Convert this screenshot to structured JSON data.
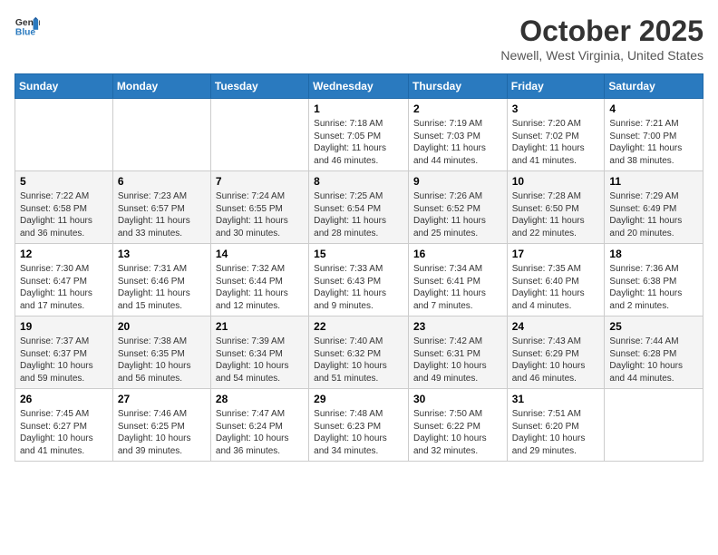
{
  "header": {
    "logo_line1": "General",
    "logo_line2": "Blue",
    "title": "October 2025",
    "subtitle": "Newell, West Virginia, United States"
  },
  "weekdays": [
    "Sunday",
    "Monday",
    "Tuesday",
    "Wednesday",
    "Thursday",
    "Friday",
    "Saturday"
  ],
  "weeks": [
    [
      {
        "day": "",
        "data": ""
      },
      {
        "day": "",
        "data": ""
      },
      {
        "day": "",
        "data": ""
      },
      {
        "day": "1",
        "data": "Sunrise: 7:18 AM\nSunset: 7:05 PM\nDaylight: 11 hours and 46 minutes."
      },
      {
        "day": "2",
        "data": "Sunrise: 7:19 AM\nSunset: 7:03 PM\nDaylight: 11 hours and 44 minutes."
      },
      {
        "day": "3",
        "data": "Sunrise: 7:20 AM\nSunset: 7:02 PM\nDaylight: 11 hours and 41 minutes."
      },
      {
        "day": "4",
        "data": "Sunrise: 7:21 AM\nSunset: 7:00 PM\nDaylight: 11 hours and 38 minutes."
      }
    ],
    [
      {
        "day": "5",
        "data": "Sunrise: 7:22 AM\nSunset: 6:58 PM\nDaylight: 11 hours and 36 minutes."
      },
      {
        "day": "6",
        "data": "Sunrise: 7:23 AM\nSunset: 6:57 PM\nDaylight: 11 hours and 33 minutes."
      },
      {
        "day": "7",
        "data": "Sunrise: 7:24 AM\nSunset: 6:55 PM\nDaylight: 11 hours and 30 minutes."
      },
      {
        "day": "8",
        "data": "Sunrise: 7:25 AM\nSunset: 6:54 PM\nDaylight: 11 hours and 28 minutes."
      },
      {
        "day": "9",
        "data": "Sunrise: 7:26 AM\nSunset: 6:52 PM\nDaylight: 11 hours and 25 minutes."
      },
      {
        "day": "10",
        "data": "Sunrise: 7:28 AM\nSunset: 6:50 PM\nDaylight: 11 hours and 22 minutes."
      },
      {
        "day": "11",
        "data": "Sunrise: 7:29 AM\nSunset: 6:49 PM\nDaylight: 11 hours and 20 minutes."
      }
    ],
    [
      {
        "day": "12",
        "data": "Sunrise: 7:30 AM\nSunset: 6:47 PM\nDaylight: 11 hours and 17 minutes."
      },
      {
        "day": "13",
        "data": "Sunrise: 7:31 AM\nSunset: 6:46 PM\nDaylight: 11 hours and 15 minutes."
      },
      {
        "day": "14",
        "data": "Sunrise: 7:32 AM\nSunset: 6:44 PM\nDaylight: 11 hours and 12 minutes."
      },
      {
        "day": "15",
        "data": "Sunrise: 7:33 AM\nSunset: 6:43 PM\nDaylight: 11 hours and 9 minutes."
      },
      {
        "day": "16",
        "data": "Sunrise: 7:34 AM\nSunset: 6:41 PM\nDaylight: 11 hours and 7 minutes."
      },
      {
        "day": "17",
        "data": "Sunrise: 7:35 AM\nSunset: 6:40 PM\nDaylight: 11 hours and 4 minutes."
      },
      {
        "day": "18",
        "data": "Sunrise: 7:36 AM\nSunset: 6:38 PM\nDaylight: 11 hours and 2 minutes."
      }
    ],
    [
      {
        "day": "19",
        "data": "Sunrise: 7:37 AM\nSunset: 6:37 PM\nDaylight: 10 hours and 59 minutes."
      },
      {
        "day": "20",
        "data": "Sunrise: 7:38 AM\nSunset: 6:35 PM\nDaylight: 10 hours and 56 minutes."
      },
      {
        "day": "21",
        "data": "Sunrise: 7:39 AM\nSunset: 6:34 PM\nDaylight: 10 hours and 54 minutes."
      },
      {
        "day": "22",
        "data": "Sunrise: 7:40 AM\nSunset: 6:32 PM\nDaylight: 10 hours and 51 minutes."
      },
      {
        "day": "23",
        "data": "Sunrise: 7:42 AM\nSunset: 6:31 PM\nDaylight: 10 hours and 49 minutes."
      },
      {
        "day": "24",
        "data": "Sunrise: 7:43 AM\nSunset: 6:29 PM\nDaylight: 10 hours and 46 minutes."
      },
      {
        "day": "25",
        "data": "Sunrise: 7:44 AM\nSunset: 6:28 PM\nDaylight: 10 hours and 44 minutes."
      }
    ],
    [
      {
        "day": "26",
        "data": "Sunrise: 7:45 AM\nSunset: 6:27 PM\nDaylight: 10 hours and 41 minutes."
      },
      {
        "day": "27",
        "data": "Sunrise: 7:46 AM\nSunset: 6:25 PM\nDaylight: 10 hours and 39 minutes."
      },
      {
        "day": "28",
        "data": "Sunrise: 7:47 AM\nSunset: 6:24 PM\nDaylight: 10 hours and 36 minutes."
      },
      {
        "day": "29",
        "data": "Sunrise: 7:48 AM\nSunset: 6:23 PM\nDaylight: 10 hours and 34 minutes."
      },
      {
        "day": "30",
        "data": "Sunrise: 7:50 AM\nSunset: 6:22 PM\nDaylight: 10 hours and 32 minutes."
      },
      {
        "day": "31",
        "data": "Sunrise: 7:51 AM\nSunset: 6:20 PM\nDaylight: 10 hours and 29 minutes."
      },
      {
        "day": "",
        "data": ""
      }
    ]
  ]
}
